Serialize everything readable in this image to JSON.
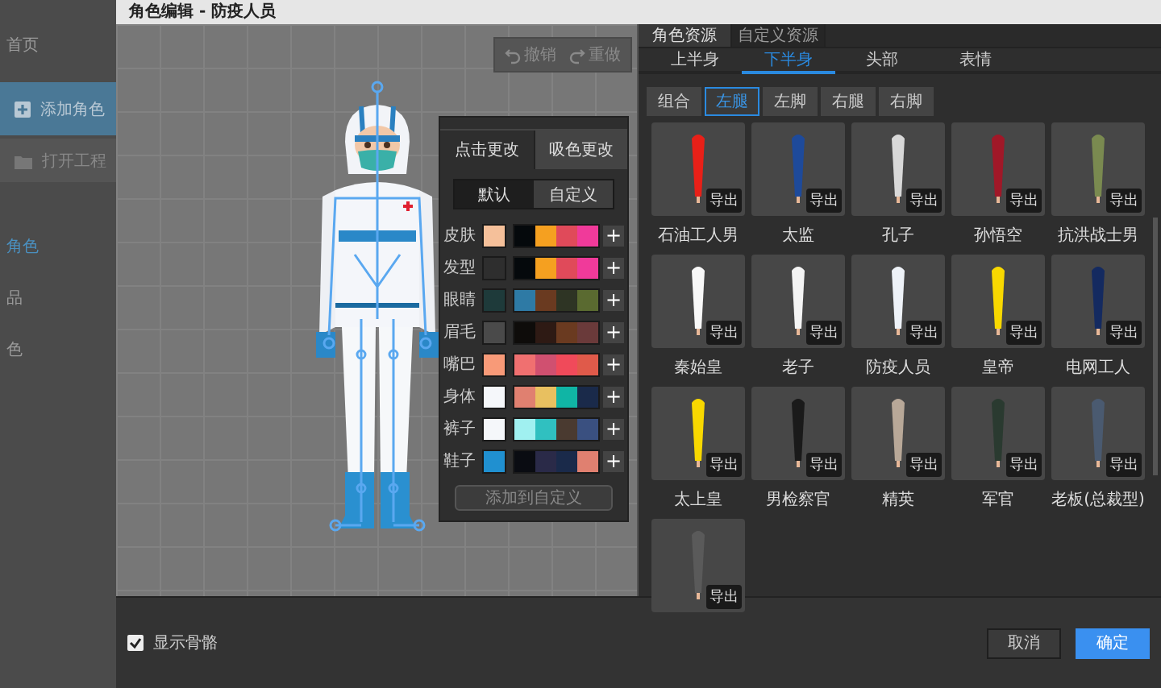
{
  "sidebar": {
    "items": [
      {
        "label": "首页",
        "kind": "link",
        "selected": false
      },
      {
        "label": "添加角色",
        "kind": "add",
        "selected": false
      },
      {
        "label": "打开工程",
        "kind": "open",
        "selected": false
      },
      {
        "label": "角色",
        "kind": "link",
        "selected": true
      },
      {
        "label": "品",
        "kind": "link",
        "selected": false
      },
      {
        "label": "色",
        "kind": "link",
        "selected": false
      }
    ]
  },
  "window": {
    "title": "角色编辑 - 防疫人员"
  },
  "canvas": {
    "toolbar": [
      {
        "label": "撤销",
        "kind": "undo",
        "disabled": true
      },
      {
        "label": "重做",
        "kind": "redo",
        "disabled": true
      }
    ]
  },
  "color_panel": {
    "modes": [
      {
        "label": "点击更改",
        "selected": true
      },
      {
        "label": "吸色更改",
        "selected": false
      }
    ],
    "presets": [
      {
        "label": "默认",
        "selected": true
      },
      {
        "label": "自定义",
        "selected": false
      }
    ],
    "rows": [
      {
        "label": "皮肤",
        "color": "#f5c09a",
        "palette": [
          {
            "color": "#05090c"
          },
          {
            "color": "#f5a020"
          },
          {
            "color": "#e04a5a"
          },
          {
            "color": "#f03a9a"
          }
        ],
        "add": "+"
      },
      {
        "label": "发型",
        "color": "#2e2e2e",
        "palette": [
          {
            "color": "#05090c"
          },
          {
            "color": "#f5a020"
          },
          {
            "color": "#e04a5a"
          },
          {
            "color": "#f03a9a"
          }
        ],
        "add": "+"
      },
      {
        "label": "眼睛",
        "color": "#1e3a3a",
        "palette": [
          {
            "color": "#2e7aa5"
          },
          {
            "color": "#6a3a20"
          },
          {
            "color": "#2e3424"
          },
          {
            "color": "#5a6a30"
          }
        ],
        "add": "+"
      },
      {
        "label": "眉毛",
        "color": "#4a4a4a",
        "palette": [
          {
            "color": "#0e0c0a"
          },
          {
            "color": "#2e1a14"
          },
          {
            "color": "#6a3a20"
          },
          {
            "color": "#6a3a3a"
          }
        ],
        "add": "+"
      },
      {
        "label": "嘴巴",
        "color": "#f89a78",
        "palette": [
          {
            "color": "#f07070"
          },
          {
            "color": "#d05070"
          },
          {
            "color": "#f04a5a"
          },
          {
            "color": "#e05a4a"
          }
        ],
        "add": "+"
      },
      {
        "label": "身体",
        "color": "#f5f7fa",
        "palette": [
          {
            "color": "#e08070"
          },
          {
            "color": "#e8c060"
          },
          {
            "color": "#10b5a5"
          },
          {
            "color": "#1a2a4a"
          }
        ],
        "add": "+"
      },
      {
        "label": "裤子",
        "color": "#f5f7fa",
        "palette": [
          {
            "color": "#a0f0f0"
          },
          {
            "color": "#30c0c0"
          },
          {
            "color": "#4a3a30"
          },
          {
            "color": "#3a5080"
          }
        ],
        "add": "+"
      },
      {
        "label": "鞋子",
        "color": "#2090d0",
        "palette": [
          {
            "color": "#0a0c12"
          },
          {
            "color": "#2a2a48"
          },
          {
            "color": "#1a2a4a"
          },
          {
            "color": "#e08070"
          }
        ],
        "add": "+"
      }
    ],
    "add_button": "添加到自定义"
  },
  "resource_tabs": [
    {
      "label": "角色资源",
      "selected": true
    },
    {
      "label": "自定义资源",
      "selected": false
    }
  ],
  "part_tabs": [
    {
      "label": "上半身",
      "selected": false
    },
    {
      "label": "下半身",
      "selected": true
    },
    {
      "label": "头部",
      "selected": false
    },
    {
      "label": "表情",
      "selected": false
    }
  ],
  "sub_parts": [
    {
      "label": "组合",
      "selected": false
    },
    {
      "label": "左腿",
      "selected": true
    },
    {
      "label": "左脚",
      "selected": false
    },
    {
      "label": "右腿",
      "selected": false
    },
    {
      "label": "右脚",
      "selected": false
    }
  ],
  "resources": [
    {
      "label": "石油工人男",
      "color": "#e82018",
      "export": "导出"
    },
    {
      "label": "太监",
      "color": "#1e4a9a",
      "export": "导出"
    },
    {
      "label": "孔子",
      "color": "#d8d8d8",
      "export": "导出"
    },
    {
      "label": "孙悟空",
      "color": "#a01828",
      "export": "导出"
    },
    {
      "label": "抗洪战士男",
      "color": "#7a8a50",
      "export": "导出"
    },
    {
      "label": "秦始皇",
      "color": "#f8f8f8",
      "export": "导出"
    },
    {
      "label": "老子",
      "color": "#f4f4f4",
      "export": "导出"
    },
    {
      "label": "防疫人员",
      "color": "#eef2f8",
      "export": "导出"
    },
    {
      "label": "皇帝",
      "color": "#f8d800",
      "export": "导出"
    },
    {
      "label": "电网工人",
      "color": "#142a60",
      "export": "导出"
    },
    {
      "label": "太上皇",
      "color": "#f8d800",
      "export": "导出"
    },
    {
      "label": "男检察官",
      "color": "#1a1a1a",
      "export": "导出"
    },
    {
      "label": "精英",
      "color": "#b8a898",
      "export": "导出"
    },
    {
      "label": "军官",
      "color": "#2a3a30",
      "export": "导出"
    },
    {
      "label": "老板(总裁型)",
      "color": "#4a5a70",
      "export": "导出"
    },
    {
      "color": "#5a5a5a",
      "export": "导出"
    }
  ],
  "footer": {
    "show_skeleton": {
      "label": "显示骨骼",
      "checked": true
    },
    "buttons": [
      {
        "label": "取消",
        "kind": "secondary"
      },
      {
        "label": "确定",
        "kind": "primary"
      }
    ]
  }
}
